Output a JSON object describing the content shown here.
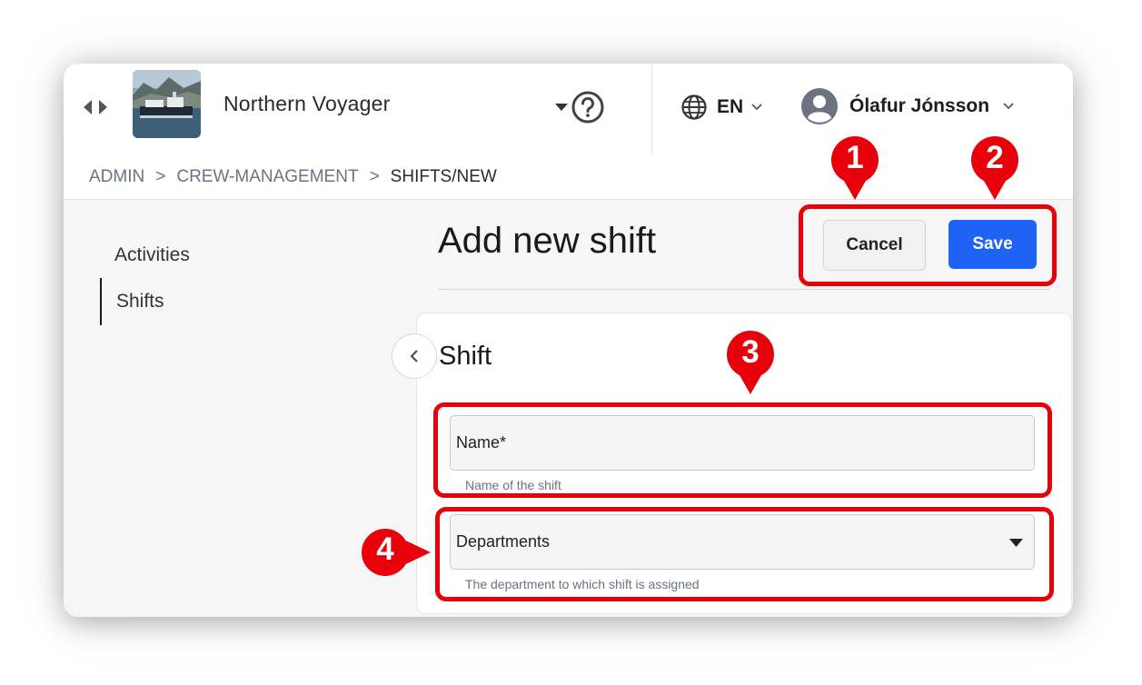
{
  "header": {
    "vessel_name": "Northern Voyager",
    "language": "EN",
    "user_name": "Ólafur Jónsson"
  },
  "breadcrumb": {
    "items": [
      "ADMIN",
      "CREW-MANAGEMENT",
      "SHIFTS/NEW"
    ],
    "separator": ">"
  },
  "sidebar": {
    "items": [
      {
        "label": "Activities",
        "active": false
      },
      {
        "label": "Shifts",
        "active": true
      }
    ]
  },
  "main": {
    "title": "Add new shift",
    "cancel_label": "Cancel",
    "save_label": "Save",
    "panel": {
      "title": "Shift",
      "name_field": {
        "label": "Name*",
        "help": "Name of the shift",
        "value": ""
      },
      "departments_field": {
        "label": "Departments",
        "help": "The department to which shift is assigned",
        "value": ""
      }
    }
  },
  "annotations": {
    "markers": [
      "1",
      "2",
      "3",
      "4"
    ],
    "color": "#e8000b"
  },
  "colors": {
    "primary": "#1e63f5",
    "annotation_red": "#e8000b"
  }
}
